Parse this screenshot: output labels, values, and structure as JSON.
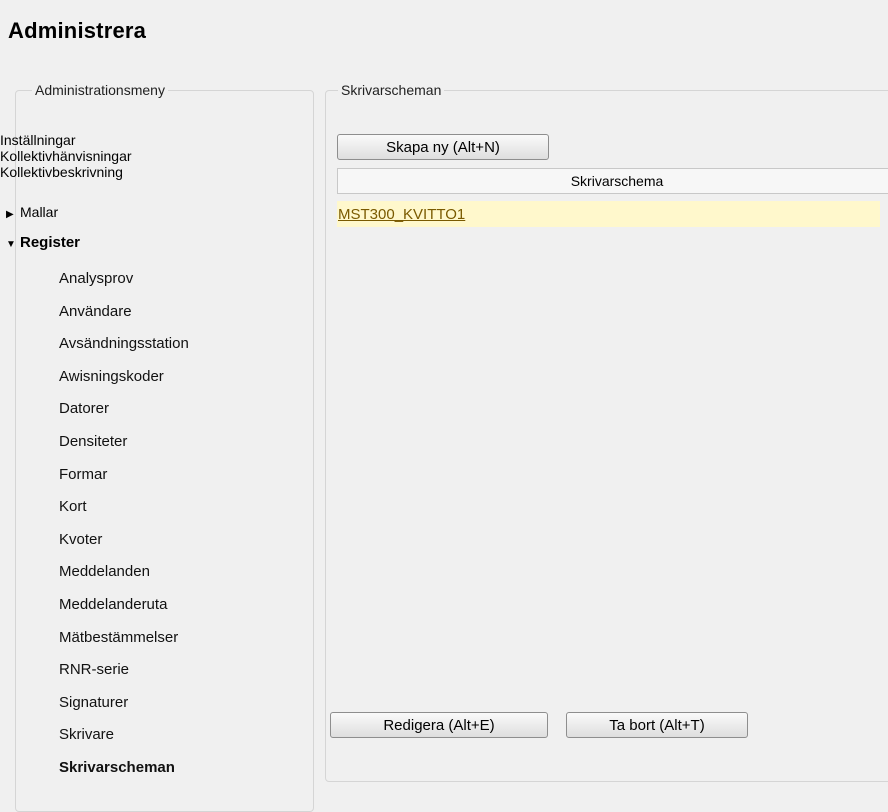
{
  "page": {
    "title": "Administrera"
  },
  "menu": {
    "legend": "Administrationsmeny",
    "top_items": [
      "Inställningar",
      "Kollektivhänvisningar",
      "Kollektivbeskrivning"
    ],
    "mallar": {
      "label": "Mallar",
      "expanded": false
    },
    "register": {
      "label": "Register",
      "expanded": true,
      "items": [
        "Analysprov",
        "Användare",
        "Avsändningsstation",
        "Awisningskoder",
        "Datorer",
        "Densiteter",
        "Formar",
        "Kort",
        "Kvoter",
        "Meddelanden",
        "Meddelanderuta",
        "Mätbestämmelser",
        "RNR-serie",
        "Signaturer",
        "Skrivare",
        "Skrivarscheman"
      ],
      "active": "Skrivarscheman"
    }
  },
  "content": {
    "legend": "Skrivarscheman",
    "create_label": "Skapa ny (Alt+N)",
    "column_header": "Skrivarschema",
    "rows": [
      "MST300_KVITTO1"
    ],
    "edit_label": "Redigera (Alt+E)",
    "delete_label": "Ta bort (Alt+T)"
  },
  "colors": {
    "selected_row": "#fff8cc",
    "link": "#7a5a00",
    "background": "#f0f0f0"
  }
}
